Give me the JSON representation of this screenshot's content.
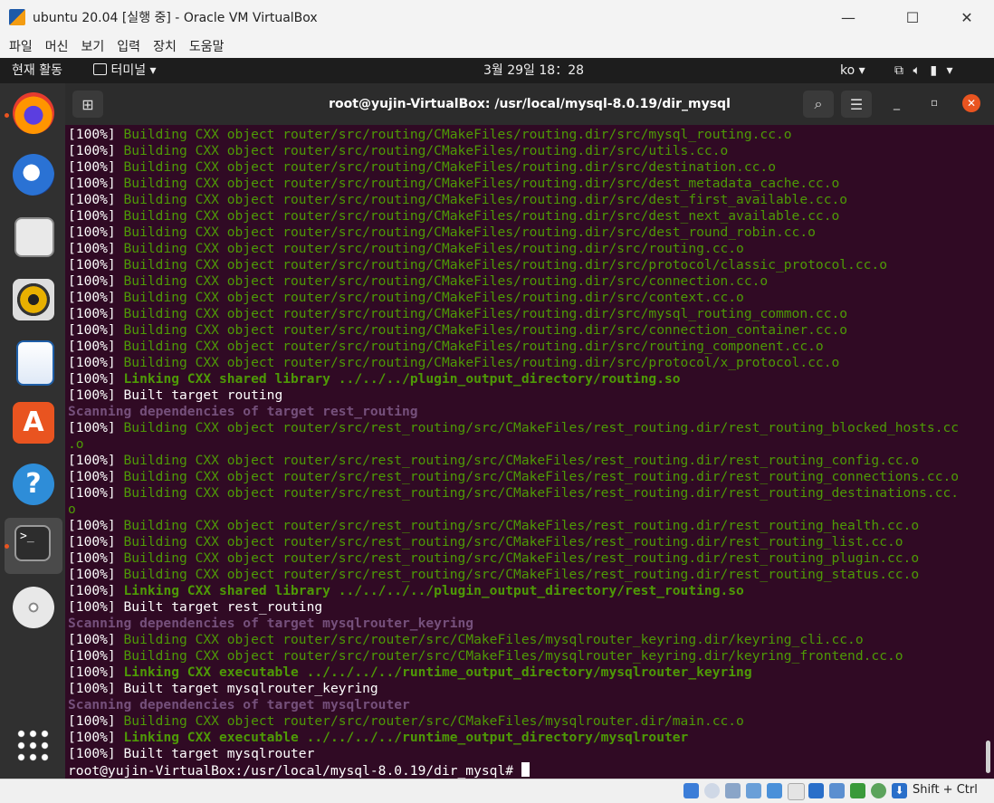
{
  "window": {
    "title": "ubuntu 20.04 [실행 중] - Oracle VM VirtualBox",
    "minimize_glyph": "—",
    "maximize_glyph": "☐",
    "close_glyph": "✕"
  },
  "vbox_menu": [
    "파일",
    "머신",
    "보기",
    "입력",
    "장치",
    "도움말"
  ],
  "gnome_topbar": {
    "activities": "현재 활동",
    "app_menu": "터미널",
    "clock": "3월 29일  18：28",
    "input_method": "ko"
  },
  "terminal": {
    "title": "root@yujin-VirtualBox: /usr/local/mysql-8.0.19/dir_mysql",
    "lines": [
      {
        "p": "[100%] ",
        "t": "Building CXX object router/src/routing/CMakeFiles/routing.dir/src/mysql_routing.cc.o",
        "s": "g"
      },
      {
        "p": "[100%] ",
        "t": "Building CXX object router/src/routing/CMakeFiles/routing.dir/src/utils.cc.o",
        "s": "g"
      },
      {
        "p": "[100%] ",
        "t": "Building CXX object router/src/routing/CMakeFiles/routing.dir/src/destination.cc.o",
        "s": "g"
      },
      {
        "p": "[100%] ",
        "t": "Building CXX object router/src/routing/CMakeFiles/routing.dir/src/dest_metadata_cache.cc.o",
        "s": "g"
      },
      {
        "p": "[100%] ",
        "t": "Building CXX object router/src/routing/CMakeFiles/routing.dir/src/dest_first_available.cc.o",
        "s": "g"
      },
      {
        "p": "[100%] ",
        "t": "Building CXX object router/src/routing/CMakeFiles/routing.dir/src/dest_next_available.cc.o",
        "s": "g"
      },
      {
        "p": "[100%] ",
        "t": "Building CXX object router/src/routing/CMakeFiles/routing.dir/src/dest_round_robin.cc.o",
        "s": "g"
      },
      {
        "p": "[100%] ",
        "t": "Building CXX object router/src/routing/CMakeFiles/routing.dir/src/routing.cc.o",
        "s": "g"
      },
      {
        "p": "[100%] ",
        "t": "Building CXX object router/src/routing/CMakeFiles/routing.dir/src/protocol/classic_protocol.cc.o",
        "s": "g"
      },
      {
        "p": "[100%] ",
        "t": "Building CXX object router/src/routing/CMakeFiles/routing.dir/src/connection.cc.o",
        "s": "g"
      },
      {
        "p": "[100%] ",
        "t": "Building CXX object router/src/routing/CMakeFiles/routing.dir/src/context.cc.o",
        "s": "g"
      },
      {
        "p": "[100%] ",
        "t": "Building CXX object router/src/routing/CMakeFiles/routing.dir/src/mysql_routing_common.cc.o",
        "s": "g"
      },
      {
        "p": "[100%] ",
        "t": "Building CXX object router/src/routing/CMakeFiles/routing.dir/src/connection_container.cc.o",
        "s": "g"
      },
      {
        "p": "[100%] ",
        "t": "Building CXX object router/src/routing/CMakeFiles/routing.dir/src/routing_component.cc.o",
        "s": "g"
      },
      {
        "p": "[100%] ",
        "t": "Building CXX object router/src/routing/CMakeFiles/routing.dir/src/protocol/x_protocol.cc.o",
        "s": "g"
      },
      {
        "p": "[100%] ",
        "t": "Linking CXX shared library ../../../plugin_output_directory/routing.so",
        "s": "gb"
      },
      {
        "p": "[100%] ",
        "t": "Built target routing",
        "s": "w"
      },
      {
        "p": "",
        "t": "Scanning dependencies of target rest_routing",
        "s": "mb"
      },
      {
        "p": "[100%] ",
        "t": "Building CXX object router/src/rest_routing/src/CMakeFiles/rest_routing.dir/rest_routing_blocked_hosts.cc",
        "s": "g"
      },
      {
        "p": "",
        "t": ".o",
        "s": "g"
      },
      {
        "p": "[100%] ",
        "t": "Building CXX object router/src/rest_routing/src/CMakeFiles/rest_routing.dir/rest_routing_config.cc.o",
        "s": "g"
      },
      {
        "p": "[100%] ",
        "t": "Building CXX object router/src/rest_routing/src/CMakeFiles/rest_routing.dir/rest_routing_connections.cc.o",
        "s": "g"
      },
      {
        "p": "[100%] ",
        "t": "Building CXX object router/src/rest_routing/src/CMakeFiles/rest_routing.dir/rest_routing_destinations.cc.",
        "s": "g"
      },
      {
        "p": "",
        "t": "o",
        "s": "g"
      },
      {
        "p": "[100%] ",
        "t": "Building CXX object router/src/rest_routing/src/CMakeFiles/rest_routing.dir/rest_routing_health.cc.o",
        "s": "g"
      },
      {
        "p": "[100%] ",
        "t": "Building CXX object router/src/rest_routing/src/CMakeFiles/rest_routing.dir/rest_routing_list.cc.o",
        "s": "g"
      },
      {
        "p": "[100%] ",
        "t": "Building CXX object router/src/rest_routing/src/CMakeFiles/rest_routing.dir/rest_routing_plugin.cc.o",
        "s": "g"
      },
      {
        "p": "[100%] ",
        "t": "Building CXX object router/src/rest_routing/src/CMakeFiles/rest_routing.dir/rest_routing_status.cc.o",
        "s": "g"
      },
      {
        "p": "[100%] ",
        "t": "Linking CXX shared library ../../../../plugin_output_directory/rest_routing.so",
        "s": "gb"
      },
      {
        "p": "[100%] ",
        "t": "Built target rest_routing",
        "s": "w"
      },
      {
        "p": "",
        "t": "Scanning dependencies of target mysqlrouter_keyring",
        "s": "mb"
      },
      {
        "p": "[100%] ",
        "t": "Building CXX object router/src/router/src/CMakeFiles/mysqlrouter_keyring.dir/keyring_cli.cc.o",
        "s": "g"
      },
      {
        "p": "[100%] ",
        "t": "Building CXX object router/src/router/src/CMakeFiles/mysqlrouter_keyring.dir/keyring_frontend.cc.o",
        "s": "g"
      },
      {
        "p": "[100%] ",
        "t": "Linking CXX executable ../../../../runtime_output_directory/mysqlrouter_keyring",
        "s": "gb"
      },
      {
        "p": "[100%] ",
        "t": "Built target mysqlrouter_keyring",
        "s": "w"
      },
      {
        "p": "",
        "t": "Scanning dependencies of target mysqlrouter",
        "s": "mb"
      },
      {
        "p": "[100%] ",
        "t": "Building CXX object router/src/router/src/CMakeFiles/mysqlrouter.dir/main.cc.o",
        "s": "g"
      },
      {
        "p": "[100%] ",
        "t": "Linking CXX executable ../../../../runtime_output_directory/mysqlrouter",
        "s": "gb"
      },
      {
        "p": "[100%] ",
        "t": "Built target mysqlrouter",
        "s": "w"
      }
    ],
    "prompt": "root@yujin-VirtualBox:/usr/local/mysql-8.0.19/dir_mysql# "
  },
  "dock": [
    "firefox-icon",
    "thunderbird-icon",
    "files-icon",
    "rhythmbox-icon",
    "libreoffice-writer-icon",
    "ubuntu-software-icon",
    "help-icon",
    "terminal-icon",
    "dvd-icon",
    "show-apps-icon"
  ],
  "statusbar": {
    "host_key": "Shift + Ctrl"
  },
  "colors": {
    "terminal_bg": "#300a24",
    "green": "#4e9a06",
    "magenta": "#75507b",
    "ubuntu_orange": "#e95420"
  }
}
